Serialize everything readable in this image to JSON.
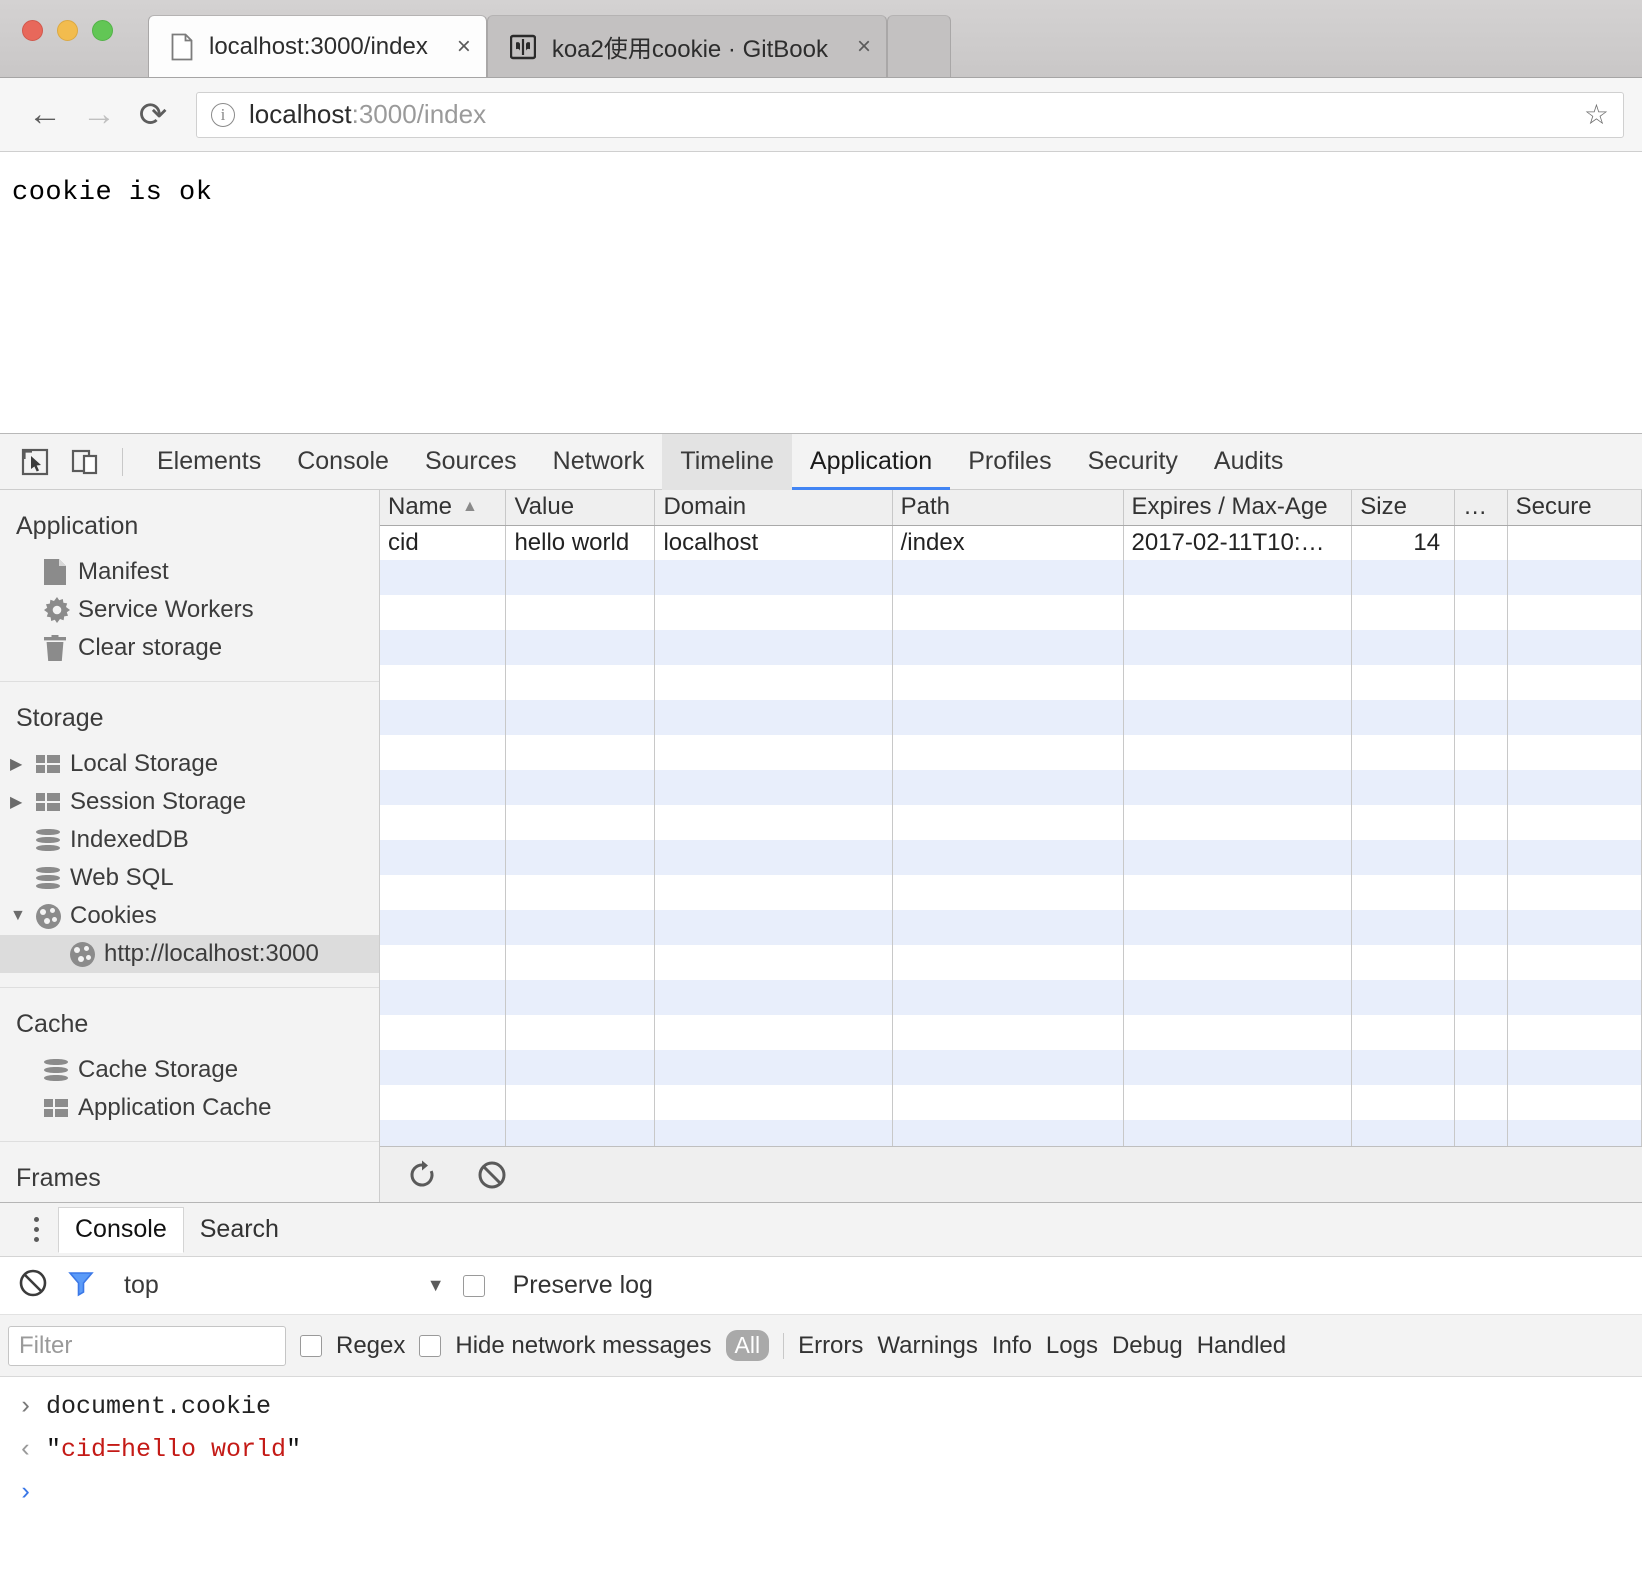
{
  "browser": {
    "tabs": [
      {
        "title": "localhost:3000/index",
        "icon": "page-icon",
        "active": true,
        "close_label": "×"
      },
      {
        "title": "koa2使用cookie · GitBook",
        "icon": "book-icon",
        "active": false,
        "close_label": "×"
      }
    ],
    "nav": {
      "back": "←",
      "forward": "→",
      "reload": "⟳"
    },
    "omnibox": {
      "security_icon": "info-icon",
      "url_host": "localhost",
      "url_rest": ":3000/index",
      "full_url": "localhost:3000/index",
      "bookmark_icon": "☆"
    }
  },
  "viewport": {
    "body_text": "cookie is ok"
  },
  "devtools": {
    "toolbar_icons": [
      "inspect-element-icon",
      "device-toolbar-icon"
    ],
    "tabs": [
      {
        "label": "Elements",
        "state": "normal"
      },
      {
        "label": "Console",
        "state": "normal"
      },
      {
        "label": "Sources",
        "state": "normal"
      },
      {
        "label": "Network",
        "state": "normal"
      },
      {
        "label": "Timeline",
        "state": "hovered"
      },
      {
        "label": "Application",
        "state": "selected"
      },
      {
        "label": "Profiles",
        "state": "normal"
      },
      {
        "label": "Security",
        "state": "normal"
      },
      {
        "label": "Audits",
        "state": "normal"
      }
    ],
    "sidebar": {
      "sections": [
        {
          "title": "Application",
          "items": [
            {
              "label": "Manifest",
              "icon": "document-icon",
              "arrow": "none",
              "selected": false,
              "nested": false
            },
            {
              "label": "Service Workers",
              "icon": "gear-icon",
              "arrow": "none",
              "selected": false,
              "nested": false
            },
            {
              "label": "Clear storage",
              "icon": "trash-icon",
              "arrow": "none",
              "selected": false,
              "nested": false
            }
          ]
        },
        {
          "title": "Storage",
          "items": [
            {
              "label": "Local Storage",
              "icon": "table-icon",
              "arrow": "collapsed",
              "selected": false,
              "nested": false
            },
            {
              "label": "Session Storage",
              "icon": "table-icon",
              "arrow": "collapsed",
              "selected": false,
              "nested": false
            },
            {
              "label": "IndexedDB",
              "icon": "database-icon",
              "arrow": "none",
              "selected": false,
              "nested": false
            },
            {
              "label": "Web SQL",
              "icon": "database-icon",
              "arrow": "none",
              "selected": false,
              "nested": false
            },
            {
              "label": "Cookies",
              "icon": "cookie-icon",
              "arrow": "expanded",
              "selected": false,
              "nested": false
            },
            {
              "label": "http://localhost:3000",
              "icon": "cookie-icon",
              "arrow": "none",
              "selected": true,
              "nested": true
            }
          ]
        },
        {
          "title": "Cache",
          "items": [
            {
              "label": "Cache Storage",
              "icon": "database-icon",
              "arrow": "none",
              "selected": false,
              "nested": false
            },
            {
              "label": "Application Cache",
              "icon": "table-icon",
              "arrow": "none",
              "selected": false,
              "nested": false
            }
          ]
        },
        {
          "title": "Frames",
          "items": []
        }
      ]
    },
    "cookie_table": {
      "columns": [
        {
          "label": "Name",
          "sorted": "asc",
          "sort_glyph": "▲"
        },
        {
          "label": "Value",
          "sorted": "none",
          "sort_glyph": ""
        },
        {
          "label": "Domain",
          "sorted": "none",
          "sort_glyph": ""
        },
        {
          "label": "Path",
          "sorted": "none",
          "sort_glyph": ""
        },
        {
          "label": "Expires / Max-Age",
          "sorted": "none",
          "sort_glyph": ""
        },
        {
          "label": "Size",
          "sorted": "none",
          "sort_glyph": ""
        },
        {
          "label": "…",
          "sorted": "none",
          "sort_glyph": ""
        },
        {
          "label": "Secure",
          "sorted": "none",
          "sort_glyph": ""
        }
      ],
      "rows": [
        {
          "name": "cid",
          "value": "hello world",
          "domain": "localhost",
          "path": "/index",
          "expires": "2017-02-11T10:…",
          "size": "14",
          "extra": "",
          "secure": ""
        }
      ],
      "empty_row_count": 18
    },
    "table_toolbar": {
      "buttons": [
        {
          "name": "refresh-button",
          "icon": "refresh-icon"
        },
        {
          "name": "clear-button",
          "icon": "block-icon"
        }
      ]
    }
  },
  "drawer": {
    "menu_icon": "kebab-menu-icon",
    "tabs": [
      {
        "label": "Console",
        "selected": true
      },
      {
        "label": "Search",
        "selected": false
      }
    ],
    "console_toolbar": {
      "clear_icon": "clear-console-icon",
      "filter_icon": "filter-funnel-icon",
      "context": "top",
      "context_caret": "▼",
      "preserve_log_label": "Preserve log",
      "preserve_log_checked": false
    },
    "filter_row": {
      "filter_placeholder": "Filter",
      "filter_value": "",
      "regex_label": "Regex",
      "regex_checked": false,
      "hide_network_label": "Hide network messages",
      "hide_network_checked": false,
      "levels": [
        {
          "label": "All",
          "active": true
        },
        {
          "label": "Errors",
          "active": false
        },
        {
          "label": "Warnings",
          "active": false
        },
        {
          "label": "Info",
          "active": false
        },
        {
          "label": "Logs",
          "active": false
        },
        {
          "label": "Debug",
          "active": false
        },
        {
          "label": "Handled",
          "active": false
        }
      ]
    },
    "console_lines": [
      {
        "kind": "input",
        "arrow": "›",
        "text": "document.cookie"
      },
      {
        "kind": "output",
        "arrow": "‹",
        "quote": "\"",
        "string": "cid=hello world"
      },
      {
        "kind": "prompt",
        "arrow": "›",
        "text": ""
      }
    ]
  },
  "colors": {
    "accent_blue": "#4285f4",
    "selection_gray": "#dcdcdc",
    "row_stripe": "#e8eefb",
    "string_red": "#c41a16"
  }
}
